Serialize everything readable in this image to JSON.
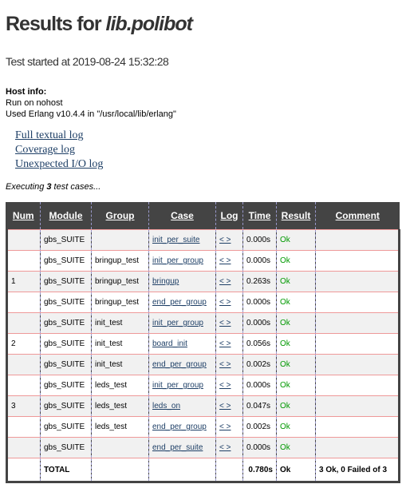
{
  "header": {
    "title_prefix": "Results for ",
    "title_name": "lib.polibot",
    "test_started": "Test started at 2019-08-24 15:32:28"
  },
  "host": {
    "label": "Host info:",
    "line1": "Run on nohost",
    "line2": "Used Erlang v10.4.4 in \"/usr/local/lib/erlang\""
  },
  "links": {
    "full_log": "Full textual log",
    "coverage_log": "Coverage log",
    "io_log": "Unexpected I/O log"
  },
  "executing": {
    "prefix": "Executing ",
    "count": "3",
    "suffix": " test cases..."
  },
  "table": {
    "headers": {
      "num": "Num",
      "module": "Module",
      "group": "Group",
      "case": "Case",
      "log": "Log",
      "time": "Time",
      "result": "Result",
      "comment": "Comment"
    },
    "rows": [
      {
        "num": "",
        "module": "gbs_SUITE",
        "group": "",
        "case": "init_per_suite",
        "log": "< >",
        "time": "0.000s",
        "result": "Ok",
        "comment": ""
      },
      {
        "num": "",
        "module": "gbs_SUITE",
        "group": "bringup_test",
        "case": "init_per_group",
        "log": "< >",
        "time": "0.000s",
        "result": "Ok",
        "comment": ""
      },
      {
        "num": "1",
        "module": "gbs_SUITE",
        "group": "bringup_test",
        "case": "bringup",
        "log": "< >",
        "time": "0.263s",
        "result": "Ok",
        "comment": ""
      },
      {
        "num": "",
        "module": "gbs_SUITE",
        "group": "bringup_test",
        "case": "end_per_group",
        "log": "< >",
        "time": "0.000s",
        "result": "Ok",
        "comment": ""
      },
      {
        "num": "",
        "module": "gbs_SUITE",
        "group": "init_test",
        "case": "init_per_group",
        "log": "< >",
        "time": "0.000s",
        "result": "Ok",
        "comment": ""
      },
      {
        "num": "2",
        "module": "gbs_SUITE",
        "group": "init_test",
        "case": "board_init",
        "log": "< >",
        "time": "0.056s",
        "result": "Ok",
        "comment": ""
      },
      {
        "num": "",
        "module": "gbs_SUITE",
        "group": "init_test",
        "case": "end_per_group",
        "log": "< >",
        "time": "0.002s",
        "result": "Ok",
        "comment": ""
      },
      {
        "num": "",
        "module": "gbs_SUITE",
        "group": "leds_test",
        "case": "init_per_group",
        "log": "< >",
        "time": "0.000s",
        "result": "Ok",
        "comment": ""
      },
      {
        "num": "3",
        "module": "gbs_SUITE",
        "group": "leds_test",
        "case": "leds_on",
        "log": "< >",
        "time": "0.047s",
        "result": "Ok",
        "comment": ""
      },
      {
        "num": "",
        "module": "gbs_SUITE",
        "group": "leds_test",
        "case": "end_per_group",
        "log": "< >",
        "time": "0.002s",
        "result": "Ok",
        "comment": ""
      },
      {
        "num": "",
        "module": "gbs_SUITE",
        "group": "",
        "case": "end_per_suite",
        "log": "< >",
        "time": "0.000s",
        "result": "Ok",
        "comment": ""
      }
    ],
    "total": {
      "label": "TOTAL",
      "time": "0.780s",
      "result": "Ok",
      "comment": "3 Ok, 0 Failed of 3"
    }
  }
}
